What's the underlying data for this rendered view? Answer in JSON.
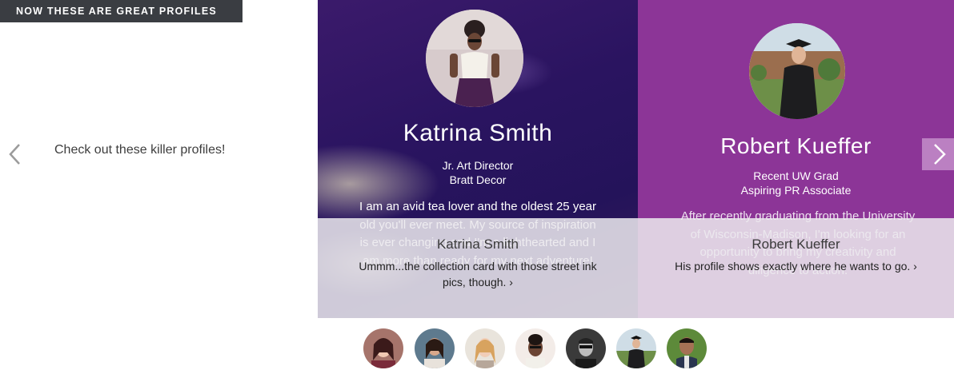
{
  "banner": {
    "label": "NOW THESE ARE GREAT PROFILES"
  },
  "intro": {
    "text": "Check out these killer profiles!"
  },
  "cards": [
    {
      "name": "Katrina Smith",
      "role_line1": "Jr. Art Director",
      "role_line2": "Bratt Decor",
      "bio": "I am an avid tea lover and the oldest 25 year old you'll ever meet. My source of inspiration is ever changing and I'm a lighthearted and I am more than ready for my next adventure!",
      "overlay_name": "Katrina Smith",
      "overlay_text": "Ummm...the collection card with those street ink pics, though. ›"
    },
    {
      "name": "Robert Kueffer",
      "role_line1": "Recent UW Grad",
      "role_line2": "Aspiring PR Associate",
      "bio": "After recently graduating from the University of Wisconsin-Madison, I'm looking for an opportunity to bring my creativity and diligence to action.",
      "overlay_name": "Robert Kueffer",
      "overlay_text": "His profile shows exactly where he wants to go. ›"
    }
  ],
  "colors": {
    "banner_bg": "#3a3d42",
    "card2_bg": "#8c3597",
    "overlay_bg": "#ebe9ee"
  },
  "icons": {
    "prev": "chevron-left-icon",
    "next": "chevron-right-icon"
  },
  "thumbnails": [
    {
      "name": "profile-thumb-1"
    },
    {
      "name": "profile-thumb-2"
    },
    {
      "name": "profile-thumb-3"
    },
    {
      "name": "profile-thumb-4"
    },
    {
      "name": "profile-thumb-5"
    },
    {
      "name": "profile-thumb-6"
    },
    {
      "name": "profile-thumb-7"
    }
  ]
}
